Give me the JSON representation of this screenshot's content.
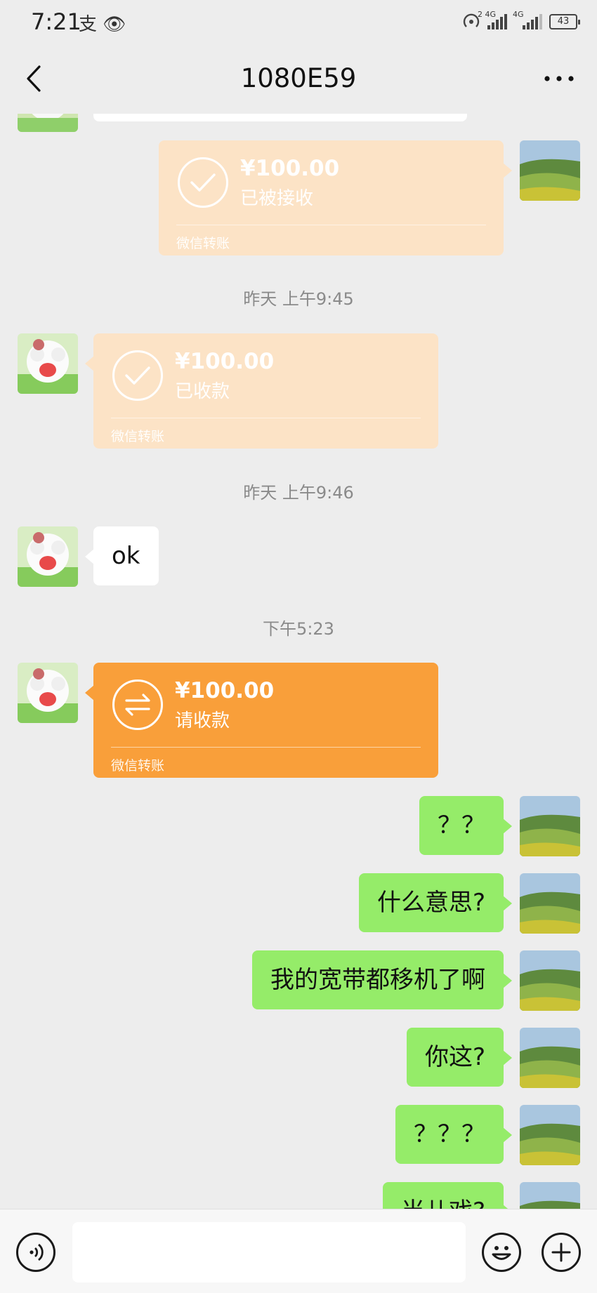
{
  "status_bar": {
    "time": "7:21",
    "left_icons": "支 👁",
    "battery": "43",
    "network_1": "2 4G",
    "network_2": "4G"
  },
  "nav": {
    "title": "1080E59",
    "back_icon": "chevron-left-icon",
    "more_icon": "more-dots-icon"
  },
  "messages": {
    "transfer_1": {
      "amount": "¥100.00",
      "status": "已被接收",
      "footer": "微信转账"
    },
    "ts_1": "昨天 上午9:45",
    "transfer_2": {
      "amount": "¥100.00",
      "status": "已收款",
      "footer": "微信转账"
    },
    "ts_2": "昨天 上午9:46",
    "ok_text": "ok",
    "ts_3": "下午5:23",
    "transfer_3": {
      "amount": "¥100.00",
      "status": "请收款",
      "footer": "微信转账"
    },
    "msg_1": "？？",
    "msg_2": "什么意思?",
    "msg_3": "我的宽带都移机了啊",
    "msg_4": "你这?",
    "msg_5": "？？？",
    "msg_6": "当儿戏?"
  },
  "colors": {
    "background": "#ededed",
    "green_bubble": "#95ec69",
    "transfer_pale": "#fce3c6",
    "transfer_orange": "#f99f3a"
  },
  "input_bar": {
    "voice_icon": "voice-icon",
    "emoji_icon": "emoji-icon",
    "plus_icon": "plus-icon"
  }
}
